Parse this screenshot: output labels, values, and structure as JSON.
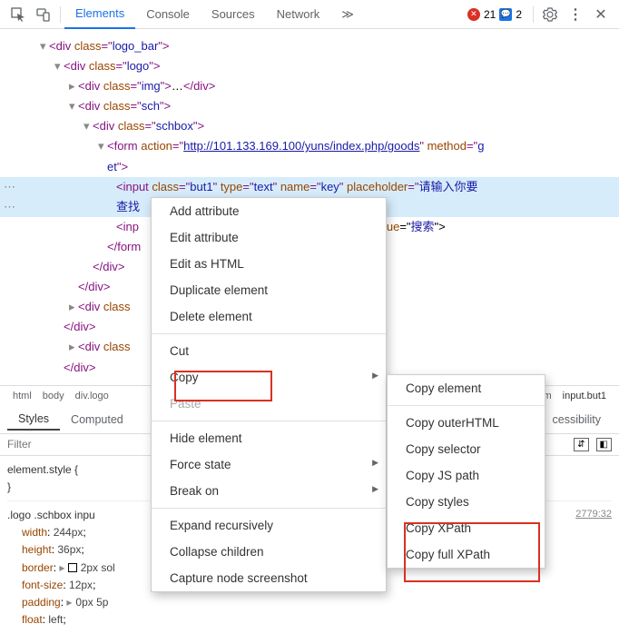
{
  "toolbar": {
    "tabs": [
      "Elements",
      "Console",
      "Sources",
      "Network"
    ],
    "active_tab": "Elements",
    "error_count": "21",
    "msg_count": "2"
  },
  "dom": {
    "l0": {
      "tag": "div",
      "attrs": "class=\"logo_bar\""
    },
    "l1": {
      "tag": "div",
      "attrs": "class=\"logo\""
    },
    "l2a": {
      "tag": "div",
      "attrs": "class=\"img\"",
      "collapsed": "…"
    },
    "l2b": {
      "tag": "div",
      "attrs": "class=\"sch\""
    },
    "l3": {
      "tag": "div",
      "attrs": "class=\"schbox\""
    },
    "l4_form_line1": "action",
    "l4_form_url": "http://101.133.169.100/yuns/index.php/goods",
    "l4_form_line2": "method",
    "l4_form_val2": "g",
    "l4_form_cont": "et",
    "selected_pre": "input",
    "selected_attrs": "class=\"but1\" type=\"text\" name=\"key\" placeholder=\"",
    "selected_placeholder": "请输入你要",
    "selected_cont": "查找",
    "inp2_frag": "inp",
    "inp2_rest": "lue=\"",
    "inp2_val": "搜索",
    "close1": "form",
    "close2": "div",
    "close3": "div",
    "l2c": {
      "tag": "div",
      "attrs_frag": "class"
    },
    "close4": "div",
    "l2d": {
      "tag": "div",
      "attrs_frag": "class"
    },
    "close5": "div"
  },
  "breadcrumb": [
    "html",
    "body",
    "div.logo",
    "form",
    "input.but1"
  ],
  "styles": {
    "tabs": [
      "Styles",
      "Computed"
    ],
    "right_tab": "cessibility",
    "filter_placeholder": "Filter",
    "rule1_sel": "element.style {",
    "rule1_close": "}",
    "rule2_sel": ".logo .schbox inpu",
    "rule2_source": "2779:32",
    "props": {
      "width": "width",
      "width_v": "244px",
      "height": "height",
      "height_v": "36px",
      "border": "border",
      "border_v": "2px sol",
      "fs": "font-size",
      "fs_v": "12px",
      "padding": "padding",
      "padding_v": "0px 5p",
      "float": "float",
      "float_v": "left"
    }
  },
  "ctx1": {
    "items": [
      "Add attribute",
      "Edit attribute",
      "Edit as HTML",
      "Duplicate element",
      "Delete element"
    ],
    "grp2": [
      "Cut",
      "Copy",
      "Paste"
    ],
    "grp3": [
      "Hide element",
      "Force state",
      "Break on"
    ],
    "grp4": [
      "Expand recursively",
      "Collapse children",
      "Capture node screenshot"
    ]
  },
  "ctx2": {
    "items": [
      "Copy element",
      "Copy outerHTML",
      "Copy selector",
      "Copy JS path",
      "Copy styles",
      "Copy XPath",
      "Copy full XPath"
    ]
  }
}
